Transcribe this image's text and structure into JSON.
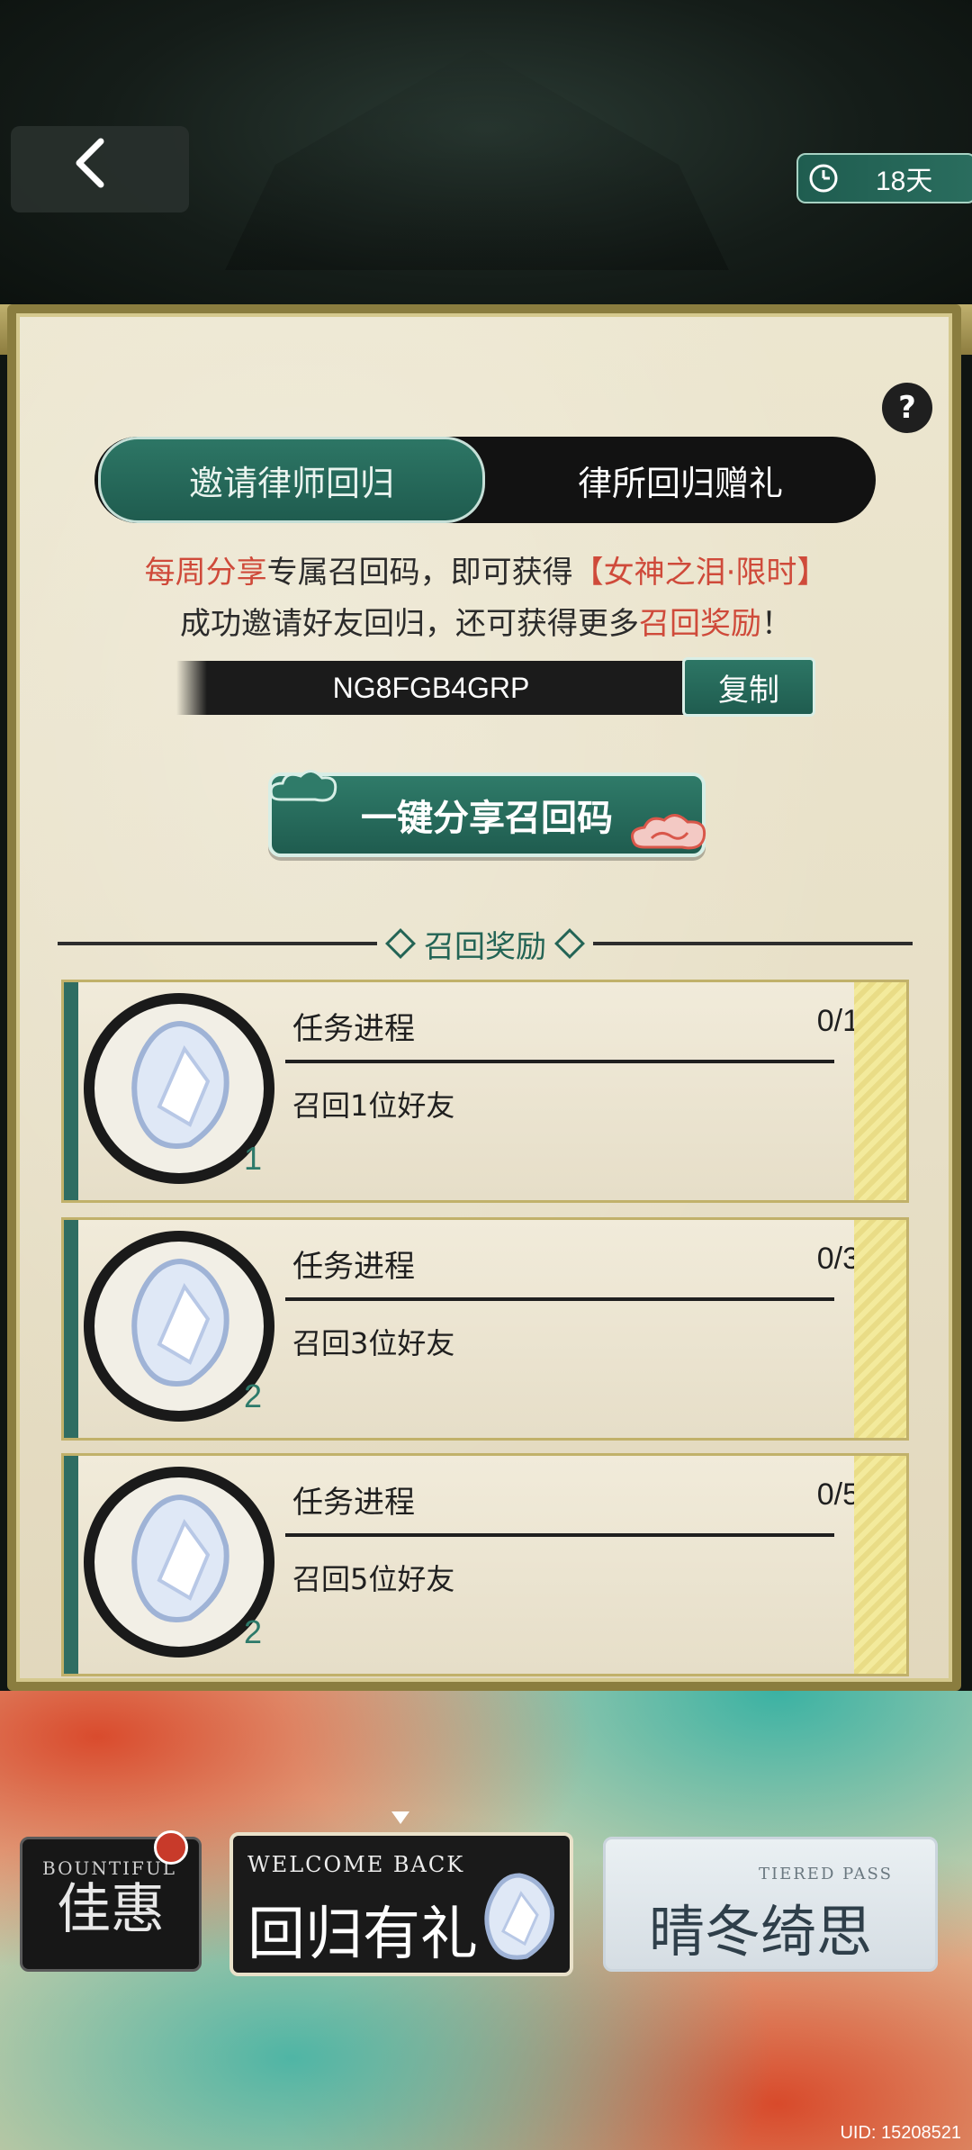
{
  "header": {
    "timer_label": "18天"
  },
  "tabs": [
    {
      "label": "邀请律师回归"
    },
    {
      "label": "律所回归赠礼"
    }
  ],
  "invite": {
    "line1_part1": "每周分享",
    "line1_part2": "专属召回码，即可获得",
    "line1_part3": "【女神之泪·限时】",
    "line2_part1": "成功邀请好友回归，还可获得更多",
    "line2_part2": "召回奖励",
    "line2_part3": "！",
    "code": "NG8FGB4GRP",
    "copy_label": "复制",
    "share_label": "一键分享召回码"
  },
  "rewards_section": {
    "title": "召回奖励",
    "items": [
      {
        "title": "任务进程",
        "progress": "0/1",
        "desc": "召回1位好友",
        "count": "1"
      },
      {
        "title": "任务进程",
        "progress": "0/3",
        "desc": "召回3位好友",
        "count": "2"
      },
      {
        "title": "任务进程",
        "progress": "0/5",
        "desc": "召回5位好友",
        "count": "2"
      }
    ]
  },
  "bottom_cards": [
    {
      "small": "BOUNTIFUL",
      "big": "佳惠"
    },
    {
      "small": "WELCOME BACK",
      "big": "回归有礼"
    },
    {
      "small": "TIERED PASS",
      "big": "晴冬绮思"
    }
  ],
  "footer": {
    "uid": "UID: 15208521"
  },
  "colors": {
    "accent_green": "#2d7665",
    "accent_red": "#cf4a3a"
  },
  "icons": [
    "back-chevron-icon",
    "clock-icon",
    "help-icon",
    "gem-icon",
    "cloud-icon"
  ]
}
